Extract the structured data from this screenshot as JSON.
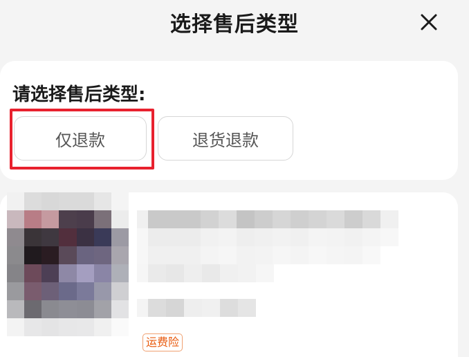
{
  "header": {
    "title": "选择售后类型",
    "close_icon": "close-icon"
  },
  "type_section": {
    "label": "请选择售后类型:",
    "options": [
      "仅退款",
      "退货退款"
    ],
    "highlighted_option": "仅退款",
    "highlight_color": "#e8212e"
  },
  "product": {
    "badge": "运费险",
    "badge_color": "#e8590c",
    "image_blurred": true,
    "name_blurred": true
  }
}
